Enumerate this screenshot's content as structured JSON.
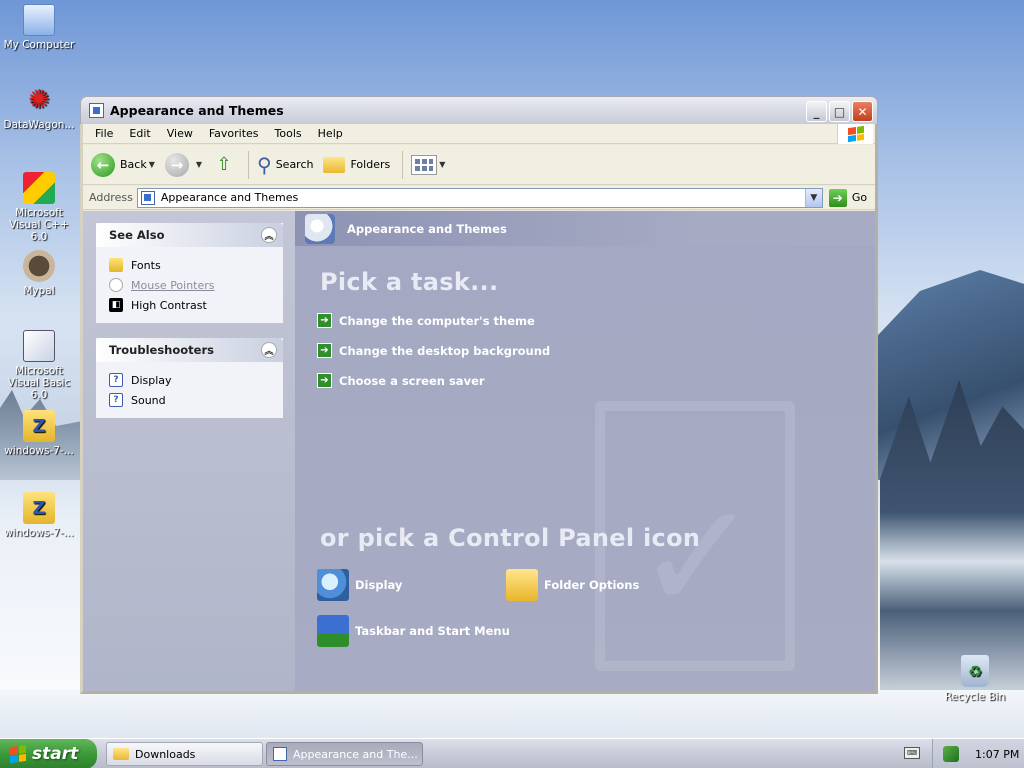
{
  "desktop": {
    "icons": [
      {
        "label": "My Computer"
      },
      {
        "label": "DataWagon..."
      },
      {
        "label": "Microsoft Visual C++ 6.0"
      },
      {
        "label": "Mypal"
      },
      {
        "label": "Microsoft Visual Basic 6.0"
      },
      {
        "label": "windows-7-..."
      },
      {
        "label": "windows-7-..."
      }
    ],
    "recycle_bin": "Recycle Bin"
  },
  "window": {
    "title": "Appearance and Themes",
    "menu": [
      "File",
      "Edit",
      "View",
      "Favorites",
      "Tools",
      "Help"
    ],
    "toolbar": {
      "back": "Back",
      "search": "Search",
      "folders": "Folders"
    },
    "address": {
      "label": "Address",
      "value": "Appearance and Themes",
      "go": "Go"
    }
  },
  "taskpane": {
    "see_also": {
      "title": "See Also",
      "items": [
        {
          "label": "Fonts"
        },
        {
          "label": "Mouse Pointers"
        },
        {
          "label": "High Contrast"
        }
      ]
    },
    "troubleshooters": {
      "title": "Troubleshooters",
      "items": [
        {
          "label": "Display"
        },
        {
          "label": "Sound"
        }
      ]
    }
  },
  "main": {
    "header": "Appearance and Themes",
    "pick_task": "Pick a task...",
    "tasks": [
      {
        "label": "Change the computer's theme"
      },
      {
        "label": "Change the desktop background"
      },
      {
        "label": "Choose a screen saver"
      }
    ],
    "pick_icon": "or pick a Control Panel icon",
    "icons": [
      {
        "label": "Display"
      },
      {
        "label": "Folder Options"
      },
      {
        "label": "Taskbar and Start Menu"
      }
    ]
  },
  "taskbar": {
    "start": "start",
    "items": [
      {
        "label": "Downloads"
      },
      {
        "label": "Appearance and The..."
      }
    ],
    "clock": "1:07 PM"
  }
}
